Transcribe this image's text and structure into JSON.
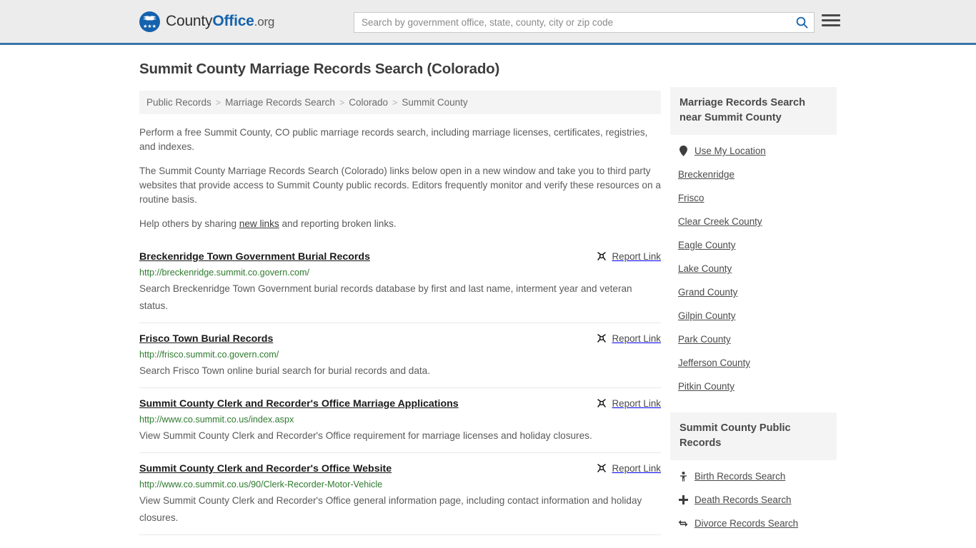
{
  "header": {
    "brand": {
      "county": "County",
      "office": "Office",
      "org": ".org",
      "emblem_icon": "eagle-seal-icon",
      "stars": "★★★"
    },
    "search": {
      "placeholder": "Search by government office, state, county, city or zip code",
      "value": "",
      "search_icon": "search-icon"
    },
    "menu_icon": "hamburger-menu-icon",
    "accent_color": "#3b73a8",
    "background_color": "#ececec"
  },
  "main": {
    "page_title": "Summit County Marriage Records Search (Colorado)",
    "breadcrumb": {
      "separator": ">",
      "items": [
        {
          "label": "Public Records",
          "current": false
        },
        {
          "label": "Marriage Records Search",
          "current": false
        },
        {
          "label": "Colorado",
          "current": false
        },
        {
          "label": "Summit County",
          "current": true
        }
      ]
    },
    "intro_paragraphs": [
      "Perform a free Summit County, CO public marriage records search, including marriage licenses, certificates, registries, and indexes.",
      "The Summit County Marriage Records Search (Colorado) links below open in a new window and take you to third party websites that provide access to Summit County public records. Editors frequently monitor and verify these resources on a routine basis."
    ],
    "share_prompt": {
      "before": "Help others by sharing ",
      "link": "new links",
      "after": " and reporting broken links."
    },
    "report_link_label": "Report Link",
    "report_link_icon": "broken-link-icon",
    "results": [
      {
        "title": "Breckenridge Town Government Burial Records",
        "url": "http://breckenridge.summit.co.govern.com/",
        "description": "Search Breckenridge Town Government burial records database by first and last name, interment year and veteran status."
      },
      {
        "title": "Frisco Town Burial Records",
        "url": "http://frisco.summit.co.govern.com/",
        "description": "Search Frisco Town online burial search for burial records and data."
      },
      {
        "title": "Summit County Clerk and Recorder's Office Marriage Applications",
        "url": "http://www.co.summit.co.us/index.aspx",
        "description": "View Summit County Clerk and Recorder's Office requirement for marriage licenses and holiday closures."
      },
      {
        "title": "Summit County Clerk and Recorder's Office Website",
        "url": "http://www.co.summit.co.us/90/Clerk-Recorder-Motor-Vehicle",
        "description": "View Summit County Clerk and Recorder's Office general information page, including contact information and holiday closures."
      }
    ],
    "url_color": "#2f7a2f"
  },
  "sidebar": {
    "nearby": {
      "heading": "Marriage Records Search near Summit County",
      "items": [
        {
          "label": "Use My Location",
          "icon": "map-pin-icon"
        },
        {
          "label": "Breckenridge",
          "icon": ""
        },
        {
          "label": "Frisco",
          "icon": ""
        },
        {
          "label": "Clear Creek County",
          "icon": ""
        },
        {
          "label": "Eagle County",
          "icon": ""
        },
        {
          "label": "Lake County",
          "icon": ""
        },
        {
          "label": "Grand County",
          "icon": ""
        },
        {
          "label": "Gilpin County",
          "icon": ""
        },
        {
          "label": "Park County",
          "icon": ""
        },
        {
          "label": "Jefferson County",
          "icon": ""
        },
        {
          "label": "Pitkin County",
          "icon": ""
        }
      ]
    },
    "public_records": {
      "heading": "Summit County Public Records",
      "items": [
        {
          "label": "Birth Records Search",
          "icon": "baby-icon"
        },
        {
          "label": "Death Records Search",
          "icon": "cross-icon"
        },
        {
          "label": "Divorce Records Search",
          "icon": "divorce-arrows-icon"
        }
      ]
    }
  }
}
